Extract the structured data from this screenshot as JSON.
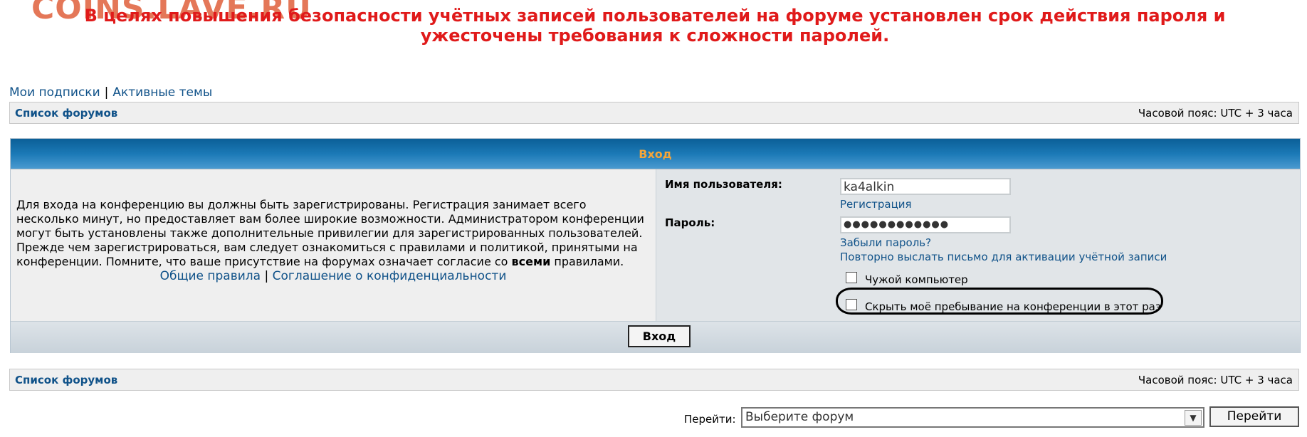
{
  "watermark": "COINS.LAVE.RU",
  "notice": "В целях повышения безопасности учётных записей пользователей на форуме установлен срок действия пароля и ужесточены требования к сложности паролей.",
  "toplinks": {
    "subscriptions": "Мои подписки",
    "separator": "|",
    "active_topics": "Активные темы"
  },
  "navbar": {
    "forum_list": "Список форумов",
    "timezone": "Часовой пояс: UTC + 3 часа"
  },
  "login": {
    "header": "Вход",
    "intro_text": "Для входа на конференцию вы должны быть зарегистрированы. Регистрация занимает всего несколько минут, но предоставляет вам более широкие возможности. Администратором конференции могут быть установлены также дополнительные привилегии для зарегистрированных пользователей. Прежде чем зарегистрироваться, вам следует ознакомиться с правилами и политикой, принятыми на конференции. Помните, что ваше присутствие на форумах означает согласие со ",
    "intro_bold": "всеми",
    "intro_end": " правилами.",
    "rules_link": "Общие правила",
    "rules_sep": "|",
    "privacy_link": "Соглашение о конфиденциальности",
    "username_label": "Имя пользователя:",
    "username_value": "ka4alkin",
    "register_link": "Регистрация",
    "password_label": "Пароль:",
    "password_value": "●●●●●●●●●●●●",
    "forgot_link": "Забыли пароль?",
    "resend_link": "Повторно выслать письмо для активации учётной записи",
    "public_pc_label": "Чужой компьютер",
    "hide_online_label": "Скрыть моё пребывание на конференции в этот раз",
    "submit_label": "Вход"
  },
  "jump": {
    "label": "Перейти:",
    "select_value": "Выберите форум",
    "go_label": "Перейти",
    "arrow": "▼"
  }
}
